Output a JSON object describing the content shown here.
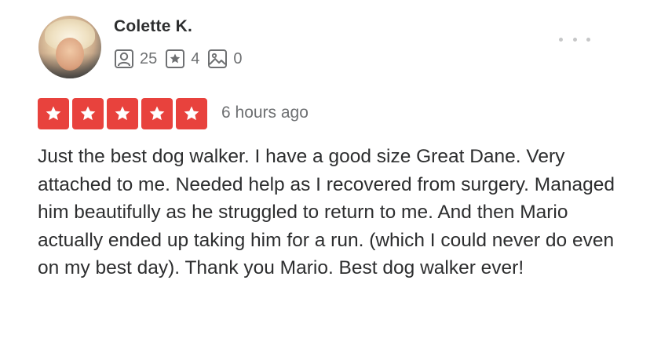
{
  "review": {
    "user_name": "Colette K.",
    "stats": {
      "friends": "25",
      "reviews": "4",
      "photos": "0"
    },
    "rating": 5,
    "rating_max": 5,
    "time_ago": "6 hours ago",
    "text": "Just the best dog walker.  I have a good size Great Dane. Very attached to me.  Needed help as I recovered from surgery.  Managed him beautifully as he struggled to return to me.  And then Mario actually ended up taking him for a run. (which I could never do even on my best day).  Thank you Mario.  Best dog walker ever!"
  },
  "icons": {
    "friends": "friends-icon",
    "reviews": "review-star-icon",
    "photos": "photo-icon",
    "more": "more-options-icon",
    "rating_star": "star-icon"
  },
  "colors": {
    "star_background": "#e8423d",
    "text_primary": "#2d2e2f",
    "text_secondary": "#6e7072"
  }
}
